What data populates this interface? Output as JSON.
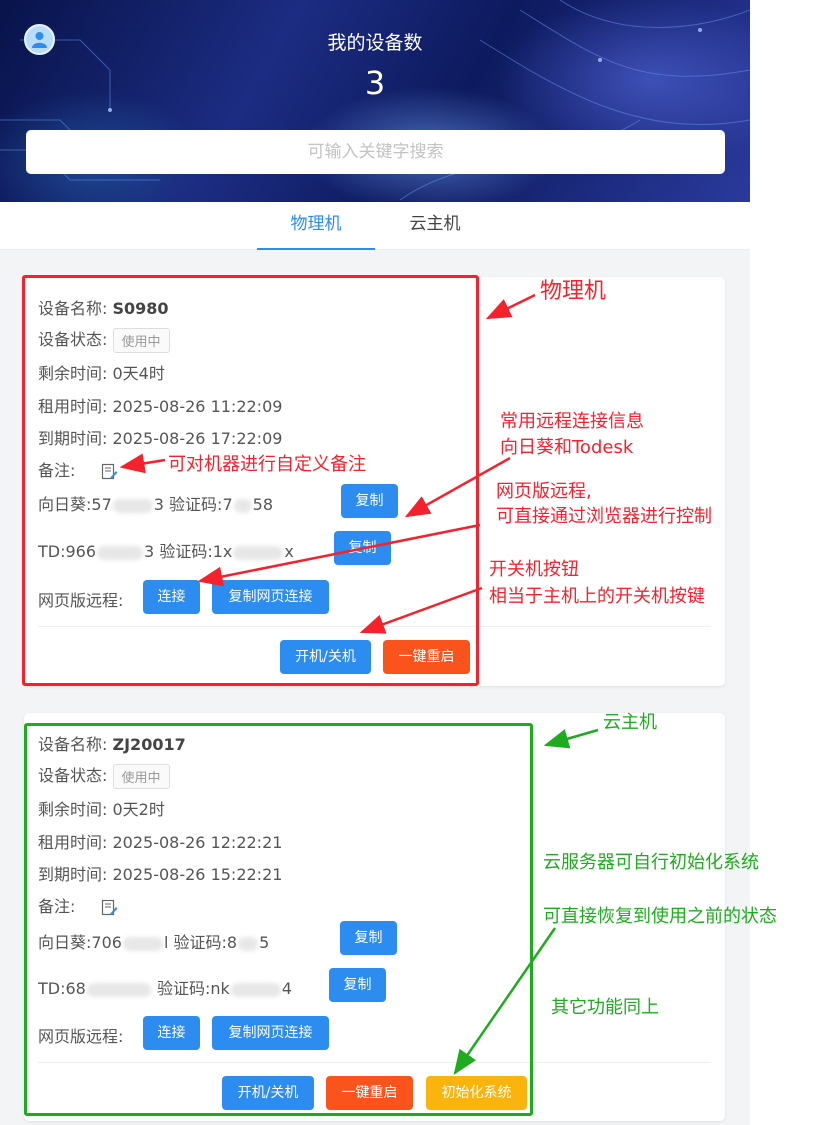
{
  "header": {
    "title": "我的设备数",
    "count": "3",
    "search_placeholder": "可输入关键字搜索"
  },
  "tabs": [
    {
      "label": "物理机",
      "active": true
    },
    {
      "label": "云主机",
      "active": false
    }
  ],
  "devices": [
    {
      "name_label": "设备名称:",
      "name": "S0980",
      "status_label": "设备状态:",
      "status": "使用中",
      "remaining_label": "剩余时间:",
      "remaining": "0天4时",
      "rent_label": "租用时间:",
      "rent_time": "2025-08-26 11:22:09",
      "expire_label": "到期时间:",
      "expire_time": "2025-08-26 17:22:09",
      "note_label": "备注:",
      "sunlogin_label": "向日葵:",
      "sunlogin_id_start": "57",
      "sunlogin_id_end": "3",
      "sunlogin_code_label": "验证码:",
      "sunlogin_code_start": "7",
      "sunlogin_code_end": "58",
      "td_label": "TD:",
      "td_id_start": "966",
      "td_id_end": "3",
      "td_code_label": "验证码:",
      "td_code_start": "1x",
      "td_code_end": "x",
      "copy_label": "复制",
      "web_label": "网页版远程:",
      "connect_label": "连接",
      "copy_web_label": "复制网页连接",
      "power_label": "开机/关机",
      "reboot_label": "一键重启"
    },
    {
      "name_label": "设备名称:",
      "name": "ZJ20017",
      "status_label": "设备状态:",
      "status": "使用中",
      "remaining_label": "剩余时间:",
      "remaining": "0天2时",
      "rent_label": "租用时间:",
      "rent_time": "2025-08-26 12:22:21",
      "expire_label": "到期时间:",
      "expire_time": "2025-08-26 15:22:21",
      "note_label": "备注:",
      "sunlogin_label": "向日葵:",
      "sunlogin_id_start": "706",
      "sunlogin_id_end": "l",
      "sunlogin_code_label": "验证码:",
      "sunlogin_code_start": "8",
      "sunlogin_code_end": "5",
      "td_label": "TD:",
      "td_id_start": "68",
      "td_id_end": "",
      "td_code_label": "验证码:",
      "td_code_start": "nk",
      "td_code_end": "4",
      "copy_label": "复制",
      "web_label": "网页版远程:",
      "connect_label": "连接",
      "copy_web_label": "复制网页连接",
      "power_label": "开机/关机",
      "reboot_label": "一键重启",
      "init_label": "初始化系统"
    }
  ],
  "annotations": {
    "physical": "物理机",
    "remote_info_1": "常用远程连接信息",
    "remote_info_2": "向日葵和Todesk",
    "note_custom": "可对机器进行自定义备注",
    "web_remote_1": "网页版远程,",
    "web_remote_2": "可直接通过浏览器进行控制",
    "power_1": "开关机按钮",
    "power_2": "相当于主机上的开关机按键",
    "cloud": "云主机",
    "cloud_init": "云服务器可自行初始化系统",
    "cloud_restore": "可直接恢复到使用之前的状态",
    "cloud_same": "其它功能同上"
  },
  "colors": {
    "primary": "#2d8cf0",
    "danger": "#fa541c",
    "warning": "#fbb40e",
    "annotation_red": "#f5222d",
    "annotation_green": "#1fab20"
  }
}
